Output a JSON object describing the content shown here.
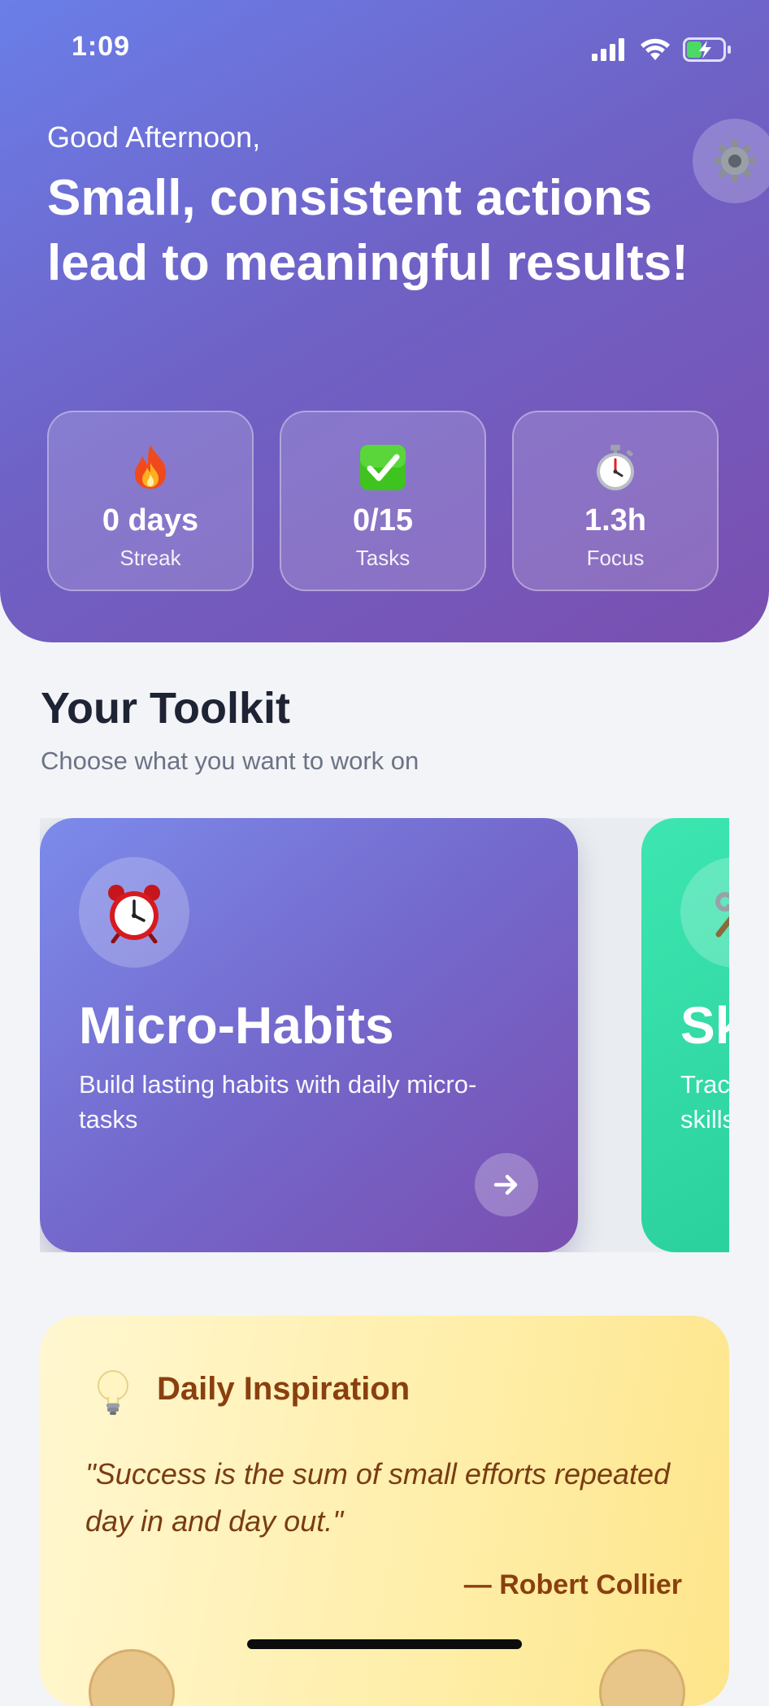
{
  "status_bar": {
    "time": "1:09"
  },
  "header": {
    "greeting": "Good Afternoon,",
    "headline": "Small, consistent actions lead to meaningful results!"
  },
  "stats": [
    {
      "icon": "fire-icon",
      "value": "0 days",
      "label": "Streak"
    },
    {
      "icon": "check-icon",
      "value": "0/15",
      "label": "Tasks"
    },
    {
      "icon": "stopwatch-icon",
      "value": "1.3h",
      "label": "Focus"
    }
  ],
  "toolkit": {
    "title": "Your Toolkit",
    "subtitle": "Choose what you want to work on",
    "cards": [
      {
        "icon": "alarm-clock-icon",
        "title": "Micro-Habits",
        "description": "Build lasting habits with daily micro-tasks"
      },
      {
        "icon": "hammer-wrench-icon",
        "title": "Sk",
        "description": "Trac skills"
      }
    ]
  },
  "inspiration": {
    "title": "Daily Inspiration",
    "quote": "\"Success is the sum of small efforts repeated day in and day out.\"",
    "author": "— Robert Collier"
  },
  "colors": {
    "header_gradient_start": "#6a7ee8",
    "header_gradient_end": "#7a4fb0",
    "skills_card": "#2ad39e",
    "inspiration_text": "#8a3f0f"
  }
}
